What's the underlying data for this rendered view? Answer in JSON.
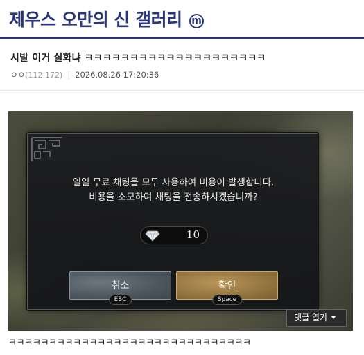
{
  "gallery": {
    "title": "제우스 오만의 신 갤러리",
    "badge": "m"
  },
  "post": {
    "title": "시발 이거 실화냐 ㅋㅋㅋㅋㅋㅋㅋㅋㅋㅋㅋㅋㅋㅋㅋㅋㅋㅋㅋㅋ",
    "author": "ㅇㅇ",
    "ip": "(112.172)",
    "date": "2026.08.26 17:20:36",
    "body": "ㅋㅋㅋㅋㅋㅋㅋㅋㅋㅋㅋㅋㅋㅋㅋㅋㅋㅋㅋㅋㅋㅋㅋㅋㅋㅋㅋㅋㅋㅋ"
  },
  "game_dialog": {
    "line1": "일일 무료 채팅을 모두 사용하여 비용이 발생합니다.",
    "line2": "비용을 소모하여 채팅을 전송하시겠습니까?",
    "cost": "10",
    "cancel_label": "취소",
    "cancel_key": "ESC",
    "confirm_label": "확인",
    "confirm_key": "Space"
  },
  "comments": {
    "toggle_label": "댓글 열기"
  }
}
